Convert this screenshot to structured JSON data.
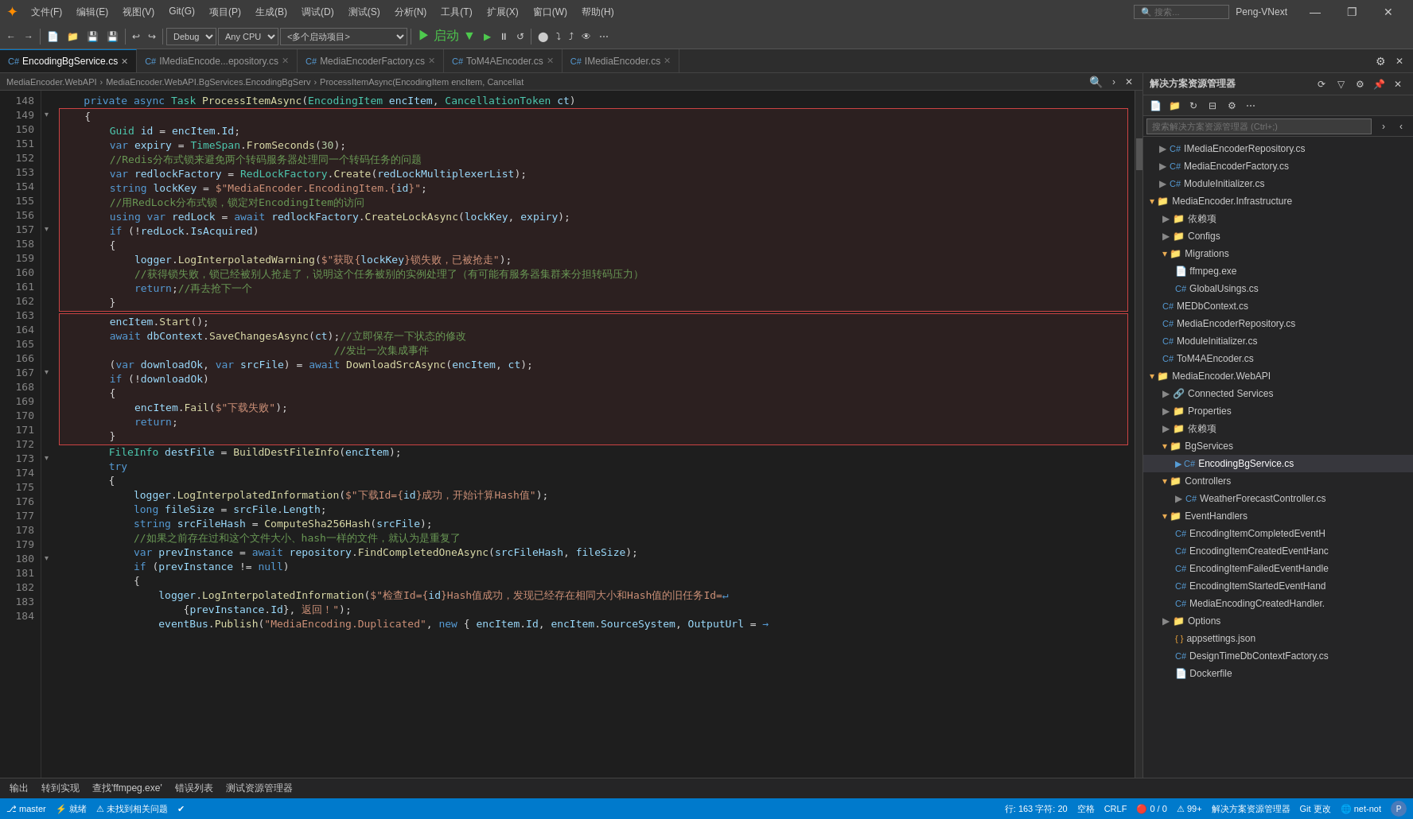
{
  "titlebar": {
    "logo": "✦",
    "menus": [
      "文件(F)",
      "编辑(E)",
      "视图(V)",
      "Git(G)",
      "项目(P)",
      "生成(B)",
      "调试(D)",
      "测试(S)",
      "分析(N)",
      "工具(T)",
      "扩展(X)",
      "窗口(W)",
      "帮助(H)"
    ],
    "search_placeholder": "搜索...",
    "profile": "Peng-VNext",
    "min_btn": "—",
    "restore_btn": "❐",
    "close_btn": "✕"
  },
  "toolbar": {
    "back": "←",
    "forward": "→",
    "debug_config": "Debug",
    "platform": "Any CPU",
    "startup": "<多个启动项目>",
    "play_label": "▶ 启动",
    "play2": "▶",
    "pause": "⏸",
    "refresh": "↺"
  },
  "tabs": [
    {
      "label": "EncodingBgService.cs",
      "active": true,
      "modified": false
    },
    {
      "label": "IMediaEncode...epository.cs",
      "active": false
    },
    {
      "label": "MediaEncoderFactory.cs",
      "active": false
    },
    {
      "label": "ToM4AEncoder.cs",
      "active": false
    },
    {
      "label": "IMediaEncoder.cs",
      "active": false
    }
  ],
  "breadcrumb": {
    "project": "MediaEncoder.WebAPI",
    "namespace": "MediaEncoder.WebAPI.BgServices.EncodingBgServ",
    "method": "ProcessItemAsync(EncodingItem encItem, Cancellat"
  },
  "code": {
    "lines": [
      {
        "num": 148,
        "text": "    private async Task ProcessItemAsync(EncodingItem encItem, CancellationToken ct)"
      },
      {
        "num": 149,
        "text": "    {"
      },
      {
        "num": 150,
        "text": "        Guid id = encItem.Id;"
      },
      {
        "num": 151,
        "text": "        var expiry = TimeSpan.FromSeconds(30);"
      },
      {
        "num": 152,
        "text": "        //Redis分布式锁来避免两个转码服务器处理同一个转码任务的问题"
      },
      {
        "num": 153,
        "text": "        var redlockFactory = RedLockFactory.Create(redLockMultiplexerList);"
      },
      {
        "num": 154,
        "text": "        string lockKey = $\"MediaEncoder.EncodingItem.{id}\";"
      },
      {
        "num": 155,
        "text": "        //用RedLock分布式锁，锁定对EncodingItem的访问"
      },
      {
        "num": 156,
        "text": "        using var redLock = await redlockFactory.CreateLockAsync(lockKey, expiry);"
      },
      {
        "num": 157,
        "text": "        if (!redLock.IsAcquired)"
      },
      {
        "num": 158,
        "text": "        {"
      },
      {
        "num": 159,
        "text": "            logger.LogInterpolatedWarning($\"获取{lockKey}锁失败，已被抢走\");"
      },
      {
        "num": 160,
        "text": "            //获得锁失败，锁已经被别人抢走了，说明这个任务被别的实例处理了（有可能有服务器集群来分担转码压力）"
      },
      {
        "num": 161,
        "text": "            return;//再去抢下一个"
      },
      {
        "num": 162,
        "text": "        }"
      },
      {
        "num": 163,
        "text": "        encItem.Start();"
      },
      {
        "num": 164,
        "text": "        await dbContext.SaveChangesAsync(ct);//立即保存一下状态的修改"
      },
      {
        "num": 165,
        "text": "                                            //发出一次集成事件"
      },
      {
        "num": 166,
        "text": "        (var downloadOk, var srcFile) = await DownloadSrcAsync(encItem, ct);"
      },
      {
        "num": 167,
        "text": "        if (!downloadOk)"
      },
      {
        "num": 168,
        "text": "        {"
      },
      {
        "num": 169,
        "text": "            encItem.Fail($\"下载失败\");"
      },
      {
        "num": 170,
        "text": "            return;"
      },
      {
        "num": 171,
        "text": "        }"
      },
      {
        "num": 172,
        "text": "        FileInfo destFile = BuildDestFileInfo(encItem);"
      },
      {
        "num": 173,
        "text": "        try"
      },
      {
        "num": 174,
        "text": "        {"
      },
      {
        "num": 175,
        "text": "            logger.LogInterpolatedInformation($\"下载Id={id}成功，开始计算Hash值\");"
      },
      {
        "num": 176,
        "text": "            long fileSize = srcFile.Length;"
      },
      {
        "num": 177,
        "text": "            string srcFileHash = ComputeSha256Hash(srcFile);"
      },
      {
        "num": 178,
        "text": "            //如果之前存在过和这个文件大小、hash一样的文件，就认为是重复了"
      },
      {
        "num": 179,
        "text": "            var prevInstance = await repository.FindCompletedOneAsync(srcFileHash, fileSize);"
      },
      {
        "num": 180,
        "text": "            if (prevInstance != null)"
      },
      {
        "num": 181,
        "text": "            {"
      },
      {
        "num": 182,
        "text": "                logger.LogInterpolatedInformation($\"检查Id={id}Hash值成功，发现已经存在相同大小和Hash值的旧任务Id="
      },
      {
        "num": 183,
        "text": "                    {prevInstance.Id}, 返回！\");"
      },
      {
        "num": 184,
        "text": "                eventBus.Publish(\"MediaEncoding.Duplicated\", new { encItem.Id, encItem.SourceSystem, OutputUrl ="
      }
    ]
  },
  "solution_explorer": {
    "title": "解决方案资源管理器",
    "search_placeholder": "搜索解决方案资源管理器 (Ctrl+;)",
    "tree": [
      {
        "level": 0,
        "type": "cs",
        "label": "IMediaEncoderRepository.cs",
        "expanded": false
      },
      {
        "level": 0,
        "type": "cs",
        "label": "MediaEncoderFactory.cs",
        "expanded": false
      },
      {
        "level": 0,
        "type": "cs",
        "label": "ModuleInitializer.cs",
        "expanded": false
      },
      {
        "level": 0,
        "type": "folder",
        "label": "MediaEncoder.Infrastructure",
        "expanded": true
      },
      {
        "level": 1,
        "type": "folder",
        "label": "依赖项",
        "expanded": false
      },
      {
        "level": 1,
        "type": "folder",
        "label": "Configs",
        "expanded": false
      },
      {
        "level": 1,
        "type": "folder",
        "label": "Migrations",
        "expanded": true
      },
      {
        "level": 2,
        "type": "exe",
        "label": "ffmpeg.exe",
        "expanded": false
      },
      {
        "level": 2,
        "type": "cs",
        "label": "GlobalUsings.cs",
        "expanded": false
      },
      {
        "level": 1,
        "type": "cs",
        "label": "MEDbContext.cs",
        "expanded": false
      },
      {
        "level": 1,
        "type": "cs",
        "label": "MediaEncoderRepository.cs",
        "expanded": false
      },
      {
        "level": 1,
        "type": "cs",
        "label": "ModuleInitializer.cs",
        "expanded": false
      },
      {
        "level": 1,
        "type": "cs",
        "label": "ToM4AEncoder.cs",
        "expanded": false
      },
      {
        "level": 0,
        "type": "folder",
        "label": "MediaEncoder.WebAPI",
        "expanded": true
      },
      {
        "level": 1,
        "type": "connected",
        "label": "Connected Services",
        "expanded": false
      },
      {
        "level": 1,
        "type": "folder",
        "label": "Properties",
        "expanded": false
      },
      {
        "level": 1,
        "type": "folder",
        "label": "依赖项",
        "expanded": false
      },
      {
        "level": 1,
        "type": "folder",
        "label": "BgServices",
        "expanded": true
      },
      {
        "level": 2,
        "type": "cs",
        "label": "EncodingBgService.cs",
        "expanded": false,
        "selected": true
      },
      {
        "level": 1,
        "type": "folder",
        "label": "Controllers",
        "expanded": true
      },
      {
        "level": 2,
        "type": "cs",
        "label": "WeatherForecastController.cs",
        "expanded": false
      },
      {
        "level": 1,
        "type": "folder",
        "label": "EventHandlers",
        "expanded": true
      },
      {
        "level": 2,
        "type": "cs",
        "label": "EncodingItemCompletedEventH",
        "expanded": false
      },
      {
        "level": 2,
        "type": "cs",
        "label": "EncodingItemCreatedEventHand",
        "expanded": false
      },
      {
        "level": 2,
        "type": "cs",
        "label": "EncodingItemFailedEventHandle",
        "expanded": false
      },
      {
        "level": 2,
        "type": "cs",
        "label": "EncodingItemStartedEventHand",
        "expanded": false
      },
      {
        "level": 2,
        "type": "cs",
        "label": "MediaEncodingCreatedHandler.",
        "expanded": false
      },
      {
        "level": 1,
        "type": "folder",
        "label": "Options",
        "expanded": false
      },
      {
        "level": 2,
        "type": "json",
        "label": "appsettings.json",
        "expanded": false
      },
      {
        "level": 2,
        "type": "cs",
        "label": "DesignTimeDbContextFactory.cs",
        "expanded": false
      },
      {
        "level": 2,
        "type": "file",
        "label": "Dockerfile",
        "expanded": false
      }
    ]
  },
  "statusbar": {
    "left_icon": "⚡",
    "status": "就绪",
    "problems": "⚠ 未找到相关问题",
    "check": "✔",
    "output": "输出",
    "goto": "转到实现",
    "find": "查找'ffmpeg.exe'",
    "errors": "错误列表",
    "test_resources": "测试资源管理器",
    "line_col": "行: 163  字符: 20",
    "spaces": "空格",
    "crlf": "CRLF",
    "errors_count": "0 / 0",
    "warnings": "99+",
    "branch": "master",
    "network": "net-not"
  }
}
